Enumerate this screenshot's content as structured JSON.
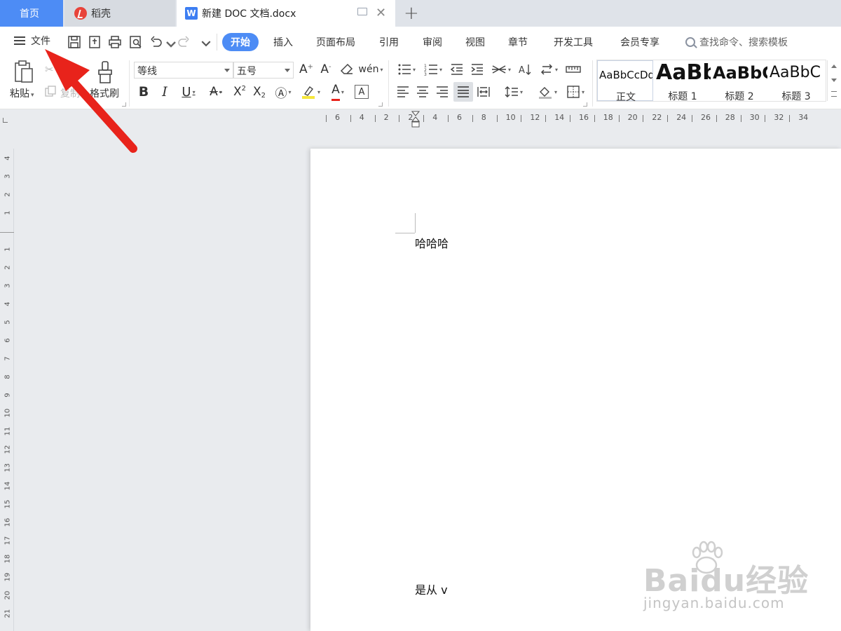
{
  "tabs": {
    "home": "首页",
    "daoke": "稻壳",
    "document": "新建 DOC 文档.docx"
  },
  "menu": {
    "file": "文件",
    "items": [
      "开始",
      "插入",
      "页面布局",
      "引用",
      "审阅",
      "视图",
      "章节",
      "开发工具",
      "会员专享"
    ],
    "search_placeholder": "查找命令、搜索模板"
  },
  "ribbon": {
    "paste": "粘贴",
    "copy": "复制",
    "cut": "剪切",
    "format_painter": "格式刷",
    "font_name": "等线",
    "font_size": "五号",
    "styles": [
      {
        "sample": "AaBbCcDd",
        "name": "正文"
      },
      {
        "sample": "AaBb",
        "name": "标题 1"
      },
      {
        "sample": "AaBbC",
        "name": "标题 2"
      },
      {
        "sample": "AaBbC",
        "name": "标题 3"
      }
    ]
  },
  "ruler": {
    "h_labels": [
      "6",
      "4",
      "2",
      "2",
      "4",
      "6",
      "8",
      "10",
      "12",
      "14",
      "16",
      "18",
      "20",
      "22",
      "24",
      "26",
      "28",
      "30",
      "32",
      "34"
    ],
    "v_labels_above": [
      "4",
      "3",
      "2",
      "1"
    ],
    "v_labels_below": [
      "1",
      "2",
      "3",
      "4",
      "5",
      "6",
      "7",
      "8",
      "9",
      "10",
      "11",
      "12",
      "13",
      "14",
      "15",
      "16",
      "17",
      "18",
      "19",
      "20",
      "21"
    ]
  },
  "document": {
    "line1": "哈哈哈",
    "line2": "是从 v"
  },
  "watermark": {
    "main": "Baidu经验",
    "sub": "jingyan.baidu.com"
  },
  "colors": {
    "accent": "#4d8cf5",
    "arrow": "#e8231b"
  }
}
